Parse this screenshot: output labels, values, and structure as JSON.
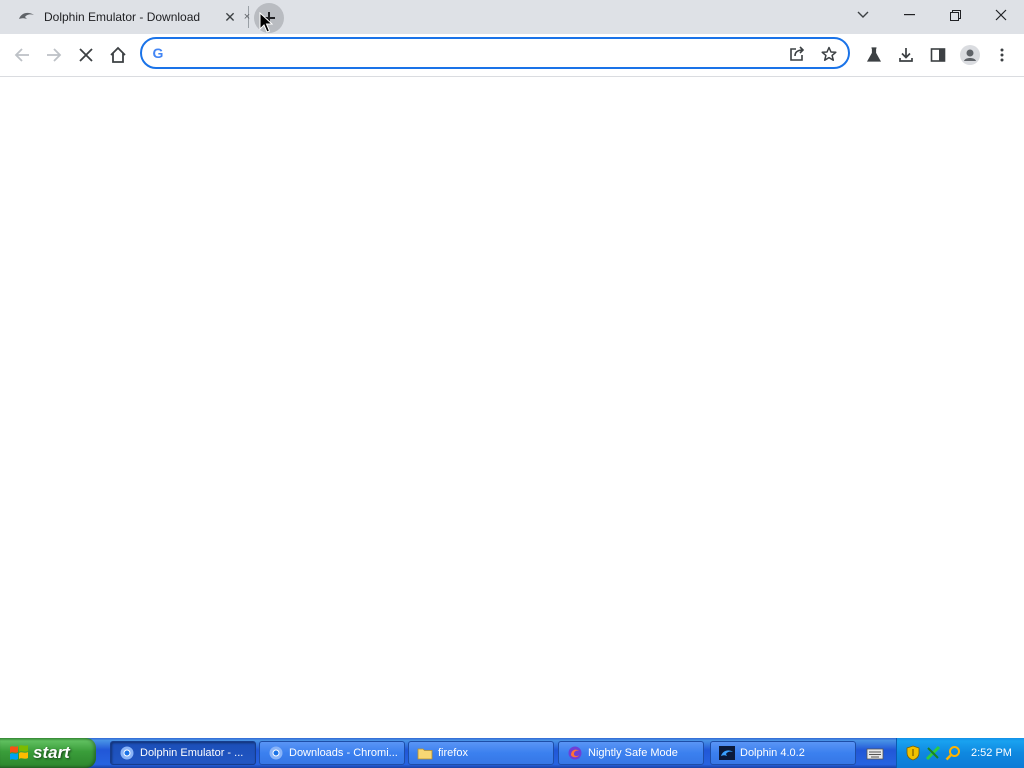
{
  "browser": {
    "tabs": [
      {
        "title": "Dolphin Emulator - Download",
        "favicon": "dolphin-icon",
        "close": "✕"
      }
    ],
    "second_tab_close": "×",
    "address_bar": {
      "value": "",
      "placeholder": ""
    }
  },
  "taskbar": {
    "start_label": "start",
    "buttons": [
      {
        "label": "Dolphin Emulator - ...",
        "icon": "chromium-icon",
        "active": true
      },
      {
        "label": "Downloads - Chromi...",
        "icon": "chromium-icon",
        "active": false
      },
      {
        "label": "firefox",
        "icon": "folder-icon",
        "active": false
      },
      {
        "label": "Nightly Safe Mode",
        "icon": "firefox-nightly-icon",
        "active": false
      },
      {
        "label": "Dolphin 4.0.2",
        "icon": "dolphin-app-icon",
        "active": false
      }
    ],
    "clock": "2:52 PM"
  },
  "colors": {
    "tabstrip": "#dee1e6",
    "omnibox_focus": "#1a73e8",
    "taskbar_blue": "#2157d7",
    "start_green": "#3a9d3a"
  }
}
